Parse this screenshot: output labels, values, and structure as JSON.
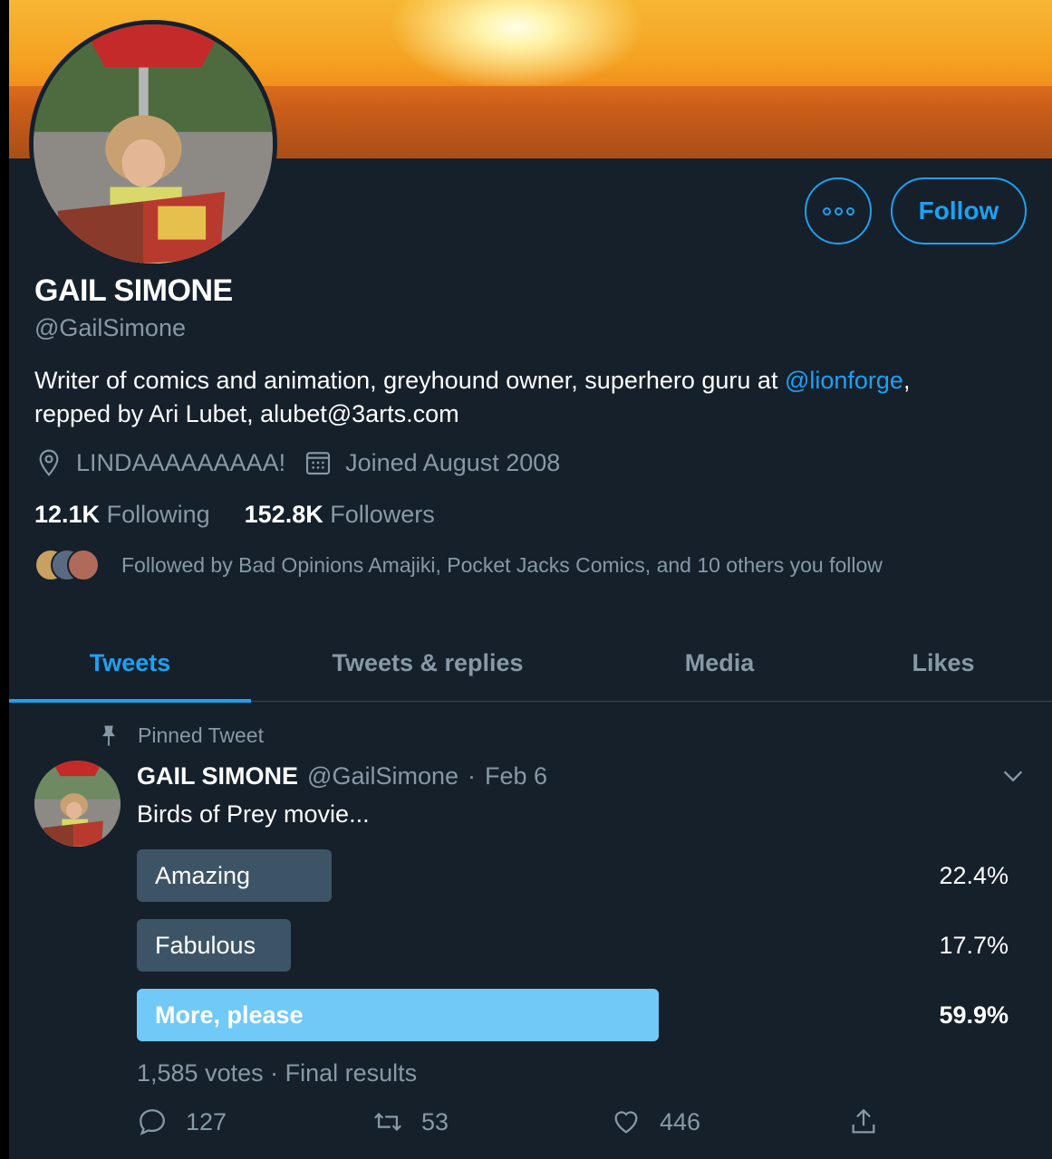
{
  "profile": {
    "name": "GAIL SIMONE",
    "handle": "@GailSimone",
    "bio_text": "Writer of comics and animation, greyhound owner, superhero guru at ",
    "bio_link": "@lionforge",
    "bio_rest": ",",
    "bio_line2": "repped by Ari Lubet, alubet@3arts.com",
    "location": "LINDAAAAAAAAA!",
    "joined": "Joined August 2008",
    "following_count": "12.1K",
    "following_label": "Following",
    "followers_count": "152.8K",
    "followers_label": "Followers",
    "followed_by": "Followed by Bad Opinions Amajiki, Pocket Jacks Comics, and 10 others you follow"
  },
  "buttons": {
    "follow": "Follow"
  },
  "tabs": [
    {
      "label": "Tweets",
      "active": true
    },
    {
      "label": "Tweets & replies",
      "active": false
    },
    {
      "label": "Media",
      "active": false
    },
    {
      "label": "Likes",
      "active": false
    }
  ],
  "tweet": {
    "pinned_label": "Pinned Tweet",
    "author": "GAIL SIMONE",
    "handle": "@GailSimone",
    "sep": "·",
    "date": "Feb 6",
    "text": "Birds of Prey movie...",
    "poll": [
      {
        "label": "Amazing",
        "percent_text": "22.4%",
        "percent": 22.4,
        "winner": false
      },
      {
        "label": "Fabulous",
        "percent_text": "17.7%",
        "percent": 17.7,
        "winner": false
      },
      {
        "label": "More, please",
        "percent_text": "59.9%",
        "percent": 59.9,
        "winner": true
      }
    ],
    "votes": "1,585 votes · Final results",
    "replies": "127",
    "retweets": "53",
    "likes": "446"
  },
  "colors": {
    "background": "#15202b",
    "accent": "#1da1f2",
    "muted": "#8899a6",
    "poll_bar": "#3d5466",
    "poll_winner": "#71c9f8"
  }
}
